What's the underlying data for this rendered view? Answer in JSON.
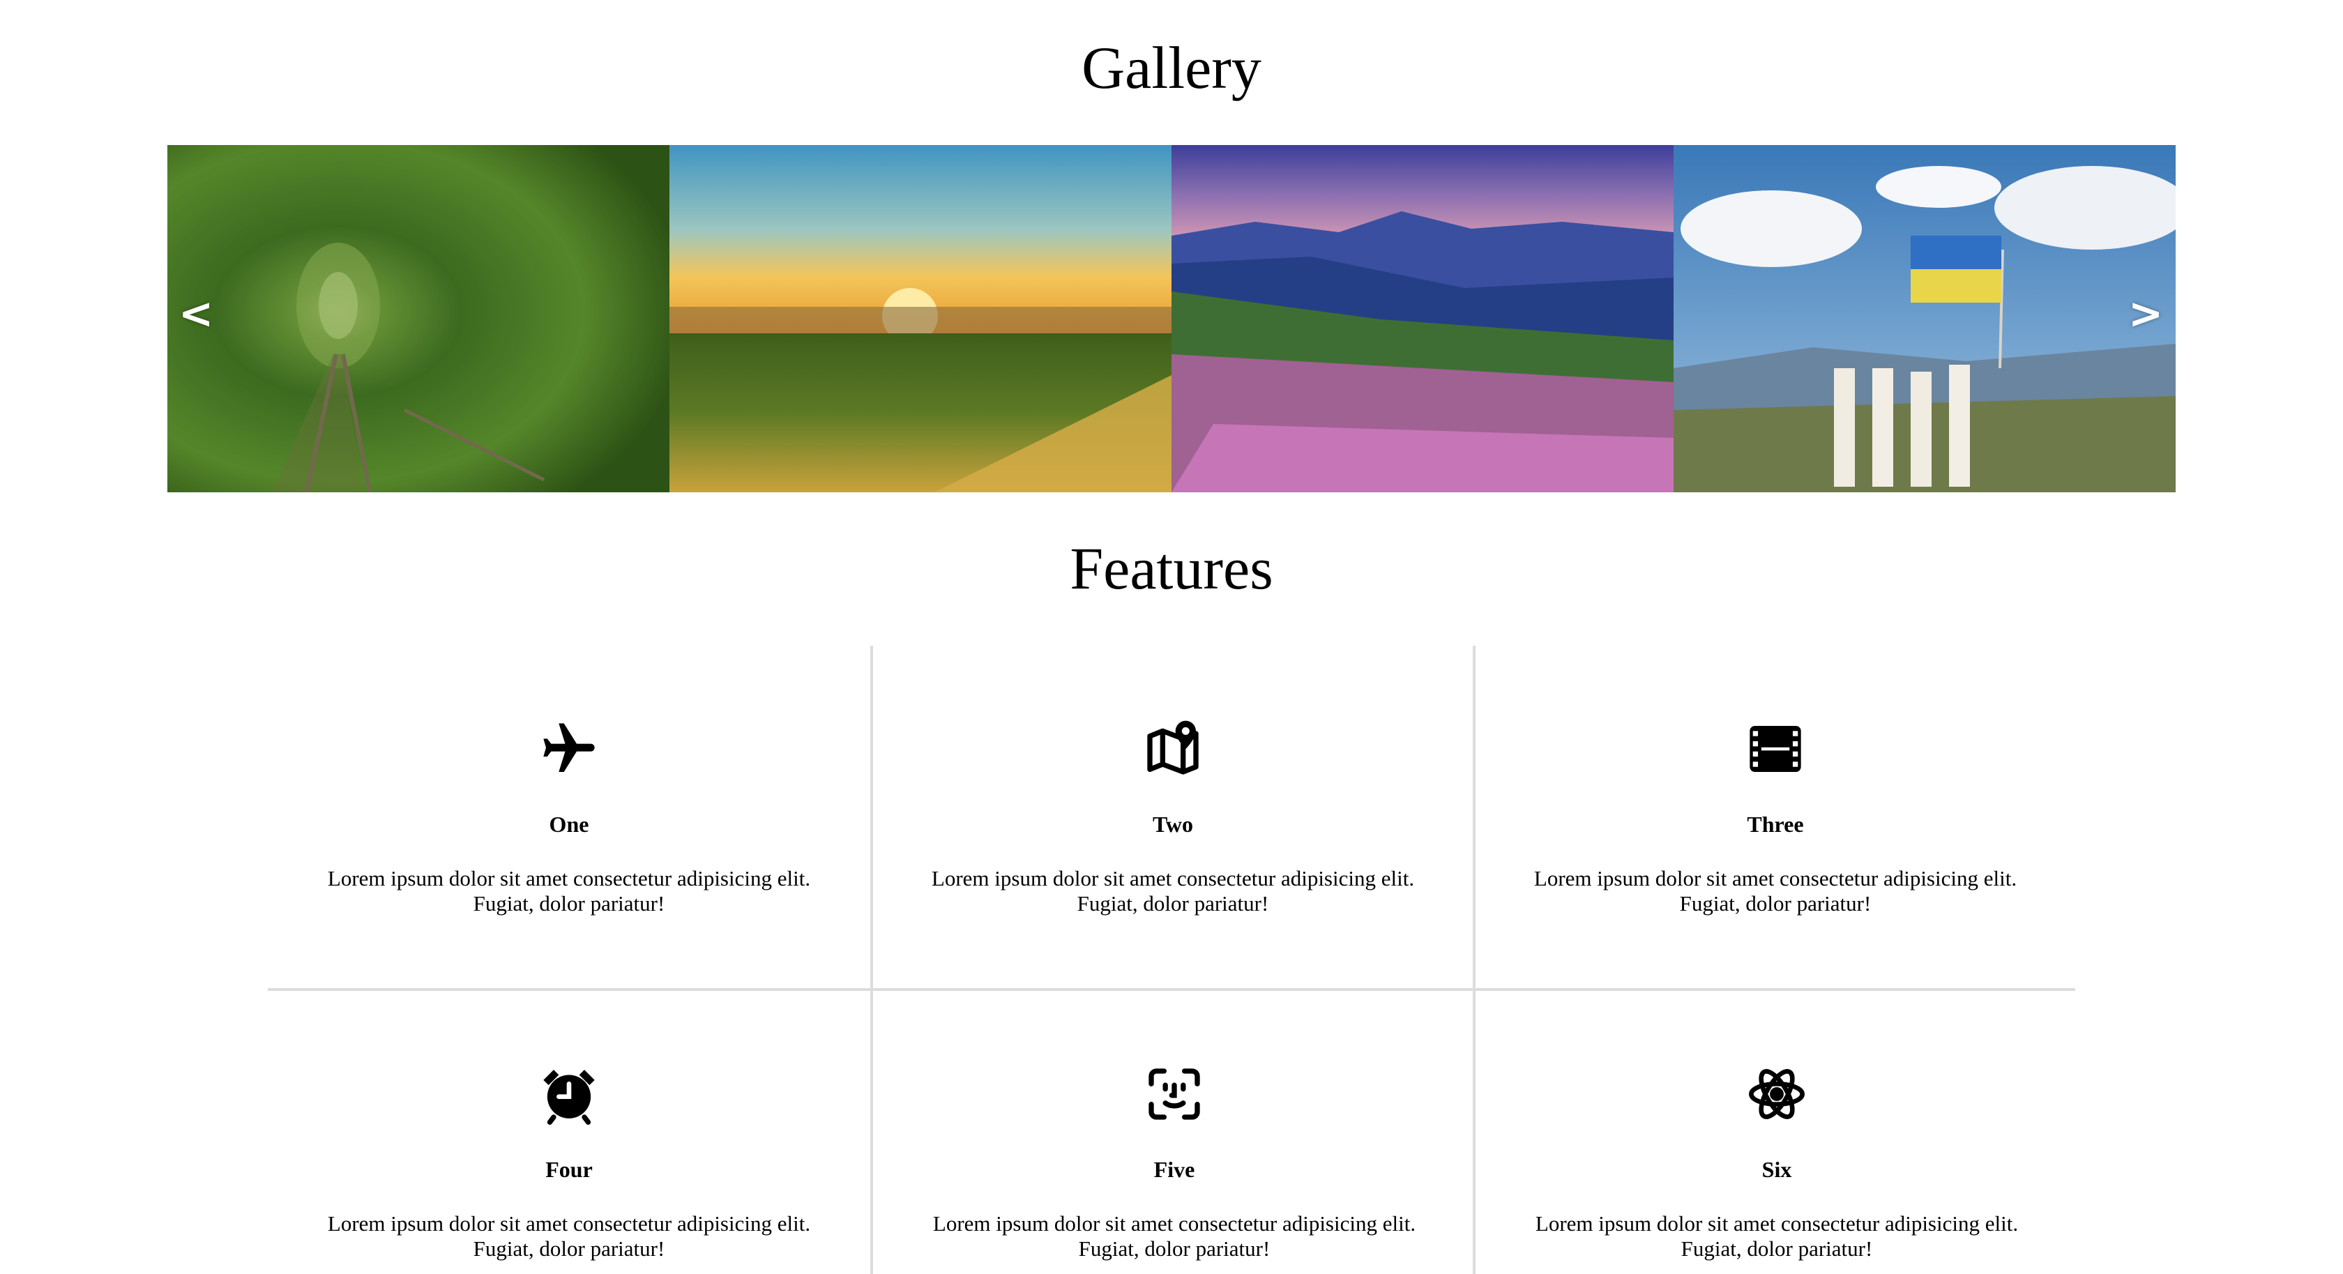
{
  "gallery": {
    "title": "Gallery",
    "prev_label": "<",
    "next_label": ">",
    "slides": [
      {
        "name": "tunnel-of-love-photo"
      },
      {
        "name": "sunflower-field-photo"
      },
      {
        "name": "mountain-flowers-photo"
      },
      {
        "name": "people-with-flag-photo"
      }
    ]
  },
  "features": {
    "title": "Features",
    "items": [
      {
        "title": "One",
        "text": "Lorem ipsum dolor sit amet consectetur adipisicing elit. Fugiat, dolor pariatur!",
        "icon": "airplane-icon"
      },
      {
        "title": "Two",
        "text": "Lorem ipsum dolor sit amet consectetur adipisicing elit. Fugiat, dolor pariatur!",
        "icon": "map-pin-icon"
      },
      {
        "title": "Three",
        "text": "Lorem ipsum dolor sit amet consectetur adipisicing elit. Fugiat, dolor pariatur!",
        "icon": "film-icon"
      },
      {
        "title": "Four",
        "text": "Lorem ipsum dolor sit amet consectetur adipisicing elit. Fugiat, dolor pariatur!",
        "icon": "alarm-clock-icon"
      },
      {
        "title": "Five",
        "text": "Lorem ipsum dolor sit amet consectetur adipisicing elit. Fugiat, dolor pariatur!",
        "icon": "face-scan-icon"
      },
      {
        "title": "Six",
        "text": "Lorem ipsum dolor sit amet consectetur adipisicing elit. Fugiat, dolor pariatur!",
        "icon": "atom-icon"
      }
    ]
  },
  "colors": {
    "divider": "#dcdcdc",
    "arrow": "#ffffff"
  }
}
